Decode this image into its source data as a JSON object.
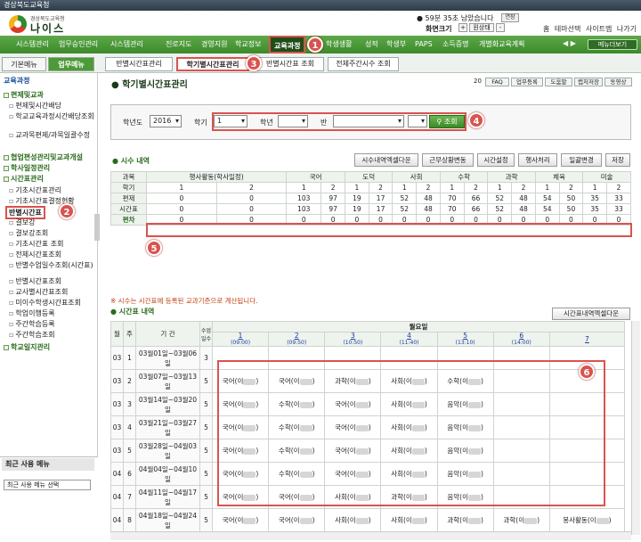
{
  "window": {
    "title": "경상북도교육청"
  },
  "header": {
    "logo_sub": "경상북도교육청",
    "logo_text": "나이스",
    "session": "59분 35초 남았습니다",
    "extend": "연장",
    "screen_size_label": "화면크기",
    "size_plus": "+",
    "size_reset": "원상태",
    "size_minus": "-",
    "top_links": [
      "홈",
      "테마선택",
      "사이트맵",
      "나가기"
    ]
  },
  "main_nav": {
    "items": [
      "시스템관리",
      "업무승인관리",
      "시스템관리",
      "진로지도",
      "경영지원",
      "학교정보",
      "교육과정",
      "학생생활",
      "성적",
      "학생부",
      "PAPS",
      "소득증명",
      "개별화교육계획"
    ],
    "active": "교육과정",
    "menu_button": "메뉴더보기"
  },
  "left_tabs": [
    "기본메뉴",
    "업무메뉴"
  ],
  "sub_tabs": [
    "반별시간표관리",
    "학기별시간표관리",
    "반별시간표 조회",
    "전체주간시수 조회"
  ],
  "sidebar": {
    "title": "교육과정",
    "sections": [
      {
        "label": "편제및교과",
        "items": [
          "편제및시간배당",
          "학교교육과정시간배당조회",
          "교과목편제/과목일괄수정"
        ]
      },
      {
        "label": "협업편성관리및교과개설",
        "items": []
      },
      {
        "label": "학사일정관리",
        "items": []
      },
      {
        "label": "시간표관리",
        "items": [
          "기초시간표관리",
          "기초시간표결정현황",
          "반별시간표",
          "결보강",
          "결보강조회",
          "기초시간표 조회",
          "전체시간표조회",
          "반별수업일수조회(시간표)",
          "반별시간표조회",
          "교사별시간표조회",
          "미이수학생시간표조회",
          "학업이행등록",
          "주간학습등록",
          "주간학습조회"
        ]
      },
      {
        "label": "학교일지관리",
        "items": []
      }
    ],
    "selected": "반별시간표"
  },
  "recent_menu": {
    "title": "최근 사용 메뉴",
    "select_placeholder": "최근 사용 메뉴 선택"
  },
  "page": {
    "title": "학기별시간표관리",
    "tool_buttons": [
      "FAQ",
      "업무등록",
      "도움말",
      "캡처저장",
      "동영상"
    ],
    "tool_num": "20"
  },
  "search": {
    "year_label": "학년도",
    "year": "2016",
    "term_label": "학기",
    "term": "1",
    "grade_label": "학년",
    "class_label": "반",
    "button": "조회"
  },
  "hours": {
    "title": "시수 내역",
    "buttons": [
      "시수내역엑셀다운",
      "근무상황변동",
      "시간설정",
      "행사처리",
      "일괄변경",
      "저장"
    ],
    "headers": [
      "과목",
      "행사활동(학사일정)",
      "국어",
      "도덕",
      "사회",
      "수학",
      "과학",
      "체육",
      "미술"
    ],
    "rows": [
      {
        "label": "학기",
        "values": [
          "1",
          "2",
          "1",
          "2",
          "1",
          "2",
          "1",
          "2",
          "1",
          "2",
          "1",
          "2",
          "1",
          "2",
          "1",
          "2"
        ]
      },
      {
        "label": "편제",
        "values": [
          "0",
          "0",
          "103",
          "97",
          "19",
          "17",
          "52",
          "48",
          "70",
          "66",
          "52",
          "48",
          "54",
          "50",
          "35",
          "33"
        ]
      },
      {
        "label": "시간표",
        "values": [
          "0",
          "0",
          "103",
          "97",
          "19",
          "17",
          "52",
          "48",
          "70",
          "66",
          "52",
          "48",
          "54",
          "50",
          "35",
          "33"
        ]
      },
      {
        "label": "편차",
        "values": [
          "0",
          "0",
          "0",
          "0",
          "0",
          "0",
          "0",
          "0",
          "0",
          "0",
          "0",
          "0",
          "0",
          "0",
          "0",
          "0"
        ]
      }
    ]
  },
  "note": "※ 시수는 시간표에 등록된 교과기준으로 계산됩니다.",
  "timetable": {
    "title": "시간표 내역",
    "export_button": "시간표내역엑셀다운",
    "day": "월요일",
    "col_headers": [
      "월",
      "주",
      "기 간",
      "수업일수"
    ],
    "periods": [
      {
        "n": "1",
        "t": "(09:00)"
      },
      {
        "n": "2",
        "t": "(09:50)"
      },
      {
        "n": "3",
        "t": "(10:50)"
      },
      {
        "n": "4",
        "t": "(11:40)"
      },
      {
        "n": "5",
        "t": "(13:10)"
      },
      {
        "n": "6",
        "t": "(14:00)"
      },
      {
        "n": "7",
        "t": ""
      }
    ],
    "rows": [
      {
        "m": "03",
        "w": "1",
        "p": "03월01일~03월06일",
        "c": "3",
        "cells": [
          "",
          "",
          "",
          "",
          "",
          "",
          ""
        ]
      },
      {
        "m": "03",
        "w": "2",
        "p": "03월07일~03월13일",
        "c": "5",
        "cells": [
          "국어(이",
          "국어(이",
          "과학(이",
          "사회(이",
          "수학(이",
          "",
          ""
        ]
      },
      {
        "m": "03",
        "w": "3",
        "p": "03월14일~03월20일",
        "c": "5",
        "cells": [
          "국어(이",
          "수학(이",
          "국어(이",
          "사회(이",
          "음악(이",
          "",
          ""
        ]
      },
      {
        "m": "03",
        "w": "4",
        "p": "03월21일~03월27일",
        "c": "5",
        "cells": [
          "국어(이",
          "수학(이",
          "국어(이",
          "사회(이",
          "음악(이",
          "",
          ""
        ]
      },
      {
        "m": "03",
        "w": "5",
        "p": "03월28일~04월03일",
        "c": "5",
        "cells": [
          "국어(이",
          "수학(이",
          "국어(이",
          "사회(이",
          "음악(이",
          "",
          ""
        ]
      },
      {
        "m": "04",
        "w": "6",
        "p": "04월04일~04월10일",
        "c": "5",
        "cells": [
          "국어(이",
          "수학(이",
          "국어(이",
          "사회(이",
          "음악(이",
          "",
          ""
        ]
      },
      {
        "m": "04",
        "w": "7",
        "p": "04월11일~04월17일",
        "c": "5",
        "cells": [
          "국어(이",
          "국어(이",
          "사회(이",
          "과학(이",
          "음악(이",
          "",
          ""
        ]
      },
      {
        "m": "04",
        "w": "8",
        "p": "04월18일~04월24일",
        "c": "5",
        "cells": [
          "국어(이",
          "국어(이",
          "사회(이",
          "사회(이",
          "과학(이",
          "과학(이",
          "봉사활동(이"
        ]
      }
    ]
  },
  "markers": [
    "1",
    "2",
    "3",
    "4",
    "5",
    "6"
  ]
}
